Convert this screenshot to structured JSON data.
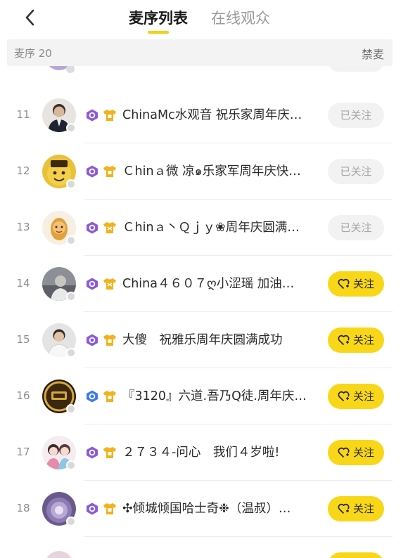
{
  "header": {
    "tabs": [
      {
        "label": "麦序列表",
        "active": true
      },
      {
        "label": "在线观众",
        "active": false
      }
    ]
  },
  "subheader": {
    "mic_count": "麦序 20",
    "ban_label": "禁麦"
  },
  "colors": {
    "accent": "#f8d718",
    "level_badge_purple": "#8a5bd6",
    "level_badge_blue": "#3d7be8",
    "shirt_badge": "#f2b21b"
  },
  "rows": [
    {
      "rank": "11",
      "name": "ChinaMc水观音 祝乐家周年庆…",
      "follow_label": "已关注",
      "followed": true,
      "level_badge": "purple-badge-icon"
    },
    {
      "rank": "12",
      "name": "Ｃhinａ微 凉๑乐家军周年庆快…",
      "follow_label": "已关注",
      "followed": true,
      "level_badge": "purple-badge-icon"
    },
    {
      "rank": "13",
      "name": "Ｃhinａ丶Ｑｊｙ❀周年庆圆满…",
      "follow_label": "已关注",
      "followed": true,
      "level_badge": "purple-badge-icon"
    },
    {
      "rank": "14",
      "name": "China４６０７ღ小涩瑶 加油…",
      "follow_label": "关注",
      "followed": false,
      "level_badge": "purple-badge-icon"
    },
    {
      "rank": "15",
      "name": "大傻　祝雅乐周年庆圆满成功",
      "follow_label": "关注",
      "followed": false,
      "level_badge": "purple-badge-icon"
    },
    {
      "rank": "16",
      "name": "『3120』六道.吾乃Q徒.周年庆…",
      "follow_label": "关注",
      "followed": false,
      "level_badge": "blue-badge-icon"
    },
    {
      "rank": "17",
      "name": "２７３４-问心　我们４岁啦!",
      "follow_label": "关注",
      "followed": false,
      "level_badge": "purple-badge-icon"
    },
    {
      "rank": "18",
      "name": "✣倾城倾国哈士奇❉（温叔）…",
      "follow_label": "关注",
      "followed": false,
      "level_badge": "purple-badge-icon"
    }
  ]
}
